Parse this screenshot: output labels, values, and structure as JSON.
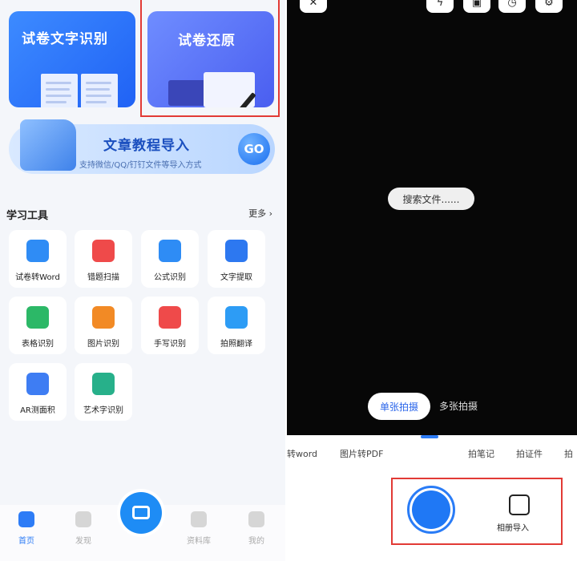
{
  "left": {
    "cards": {
      "ocr": {
        "title": "试卷文字识别"
      },
      "restore": {
        "title": "试卷还原"
      }
    },
    "banner": {
      "title": "文章教程导入",
      "subtitle": "支持微信/QQ/钉钉文件等导入方式",
      "go": "GO"
    },
    "tools_section": {
      "title": "学习工具",
      "more": "更多 ›"
    },
    "tools": [
      {
        "label": "试卷转Word",
        "color": "#2f8cf5"
      },
      {
        "label": "错题扫描",
        "color": "#ef4a4a"
      },
      {
        "label": "公式识别",
        "color": "#2e8cf5"
      },
      {
        "label": "文字提取",
        "color": "#2d78f0"
      },
      {
        "label": "表格识别",
        "color": "#2cb867"
      },
      {
        "label": "图片识别",
        "color": "#f28a25"
      },
      {
        "label": "手写识别",
        "color": "#ef4a4a"
      },
      {
        "label": "拍照翻译",
        "color": "#2d9cf5"
      },
      {
        "label": "AR测面积",
        "color": "#3e7df3"
      },
      {
        "label": "艺术字识别",
        "color": "#27b08a"
      }
    ],
    "nav": [
      {
        "label": "首页",
        "active": true
      },
      {
        "label": "发现",
        "active": false
      },
      {
        "label": "资料库",
        "active": false
      },
      {
        "label": "我的",
        "active": false
      }
    ]
  },
  "right": {
    "search_hint": "搜索文件......",
    "modes": {
      "single": "单张拍摄",
      "multi": "多张拍摄"
    },
    "feature_tabs": [
      "转word",
      "图片转PDF",
      "拍笔记",
      "拍证件",
      "拍"
    ],
    "album_import": "相册导入",
    "top_icons": [
      "close-icon",
      "flash-off-icon",
      "hd-icon",
      "timer-icon",
      "settings-icon"
    ]
  }
}
